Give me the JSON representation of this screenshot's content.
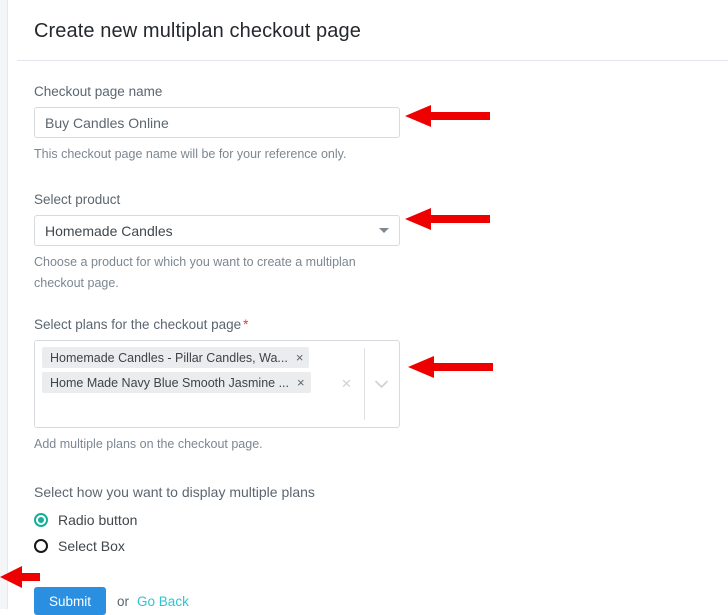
{
  "header": {
    "title": "Create new multiplan checkout page"
  },
  "form": {
    "checkout_name": {
      "label": "Checkout page name",
      "value": "Buy Candles Online",
      "placeholder": "Checkout page name",
      "help": "This checkout page name will be for your reference only."
    },
    "product": {
      "label": "Select product",
      "value": "Homemade Candles",
      "help": "Choose a product for which you want to create a multiplan checkout page.",
      "caret_icon": "caret-down-icon"
    },
    "plans": {
      "label": "Select plans for the checkout page",
      "required_marker": "*",
      "help": "Add multiple plans on the checkout page.",
      "chips": [
        {
          "label": "Homemade Candles - Pillar Candles, Wa...",
          "remove_icon": "×"
        },
        {
          "label": "Home Made Navy Blue Smooth Jasmine ...",
          "remove_icon": "×"
        }
      ],
      "clear_icon": "×",
      "chevron_icon": "chevron-down-icon"
    },
    "display_mode": {
      "label": "Select how you want to display multiple plans",
      "options": [
        {
          "label": "Radio button",
          "selected": true
        },
        {
          "label": "Select Box",
          "selected": false
        }
      ]
    }
  },
  "actions": {
    "submit_label": "Submit",
    "or_label": "or",
    "go_back_label": "Go Back"
  },
  "colors": {
    "accent_blue": "#2a8fe0",
    "link_teal": "#2ec3d6",
    "radio_teal": "#15b097",
    "required_red": "#e8353d",
    "annotation_red": "#ee0000",
    "border": "#d7dbe0",
    "label_gray": "#5b6670"
  },
  "annotations": [
    {
      "name": "arrow-to-checkout-name",
      "target": "checkout-page-name-input"
    },
    {
      "name": "arrow-to-product-select",
      "target": "product-select"
    },
    {
      "name": "arrow-to-plans-multiselect",
      "target": "plans-multiselect"
    },
    {
      "name": "arrow-to-submit",
      "target": "submit-button"
    }
  ]
}
